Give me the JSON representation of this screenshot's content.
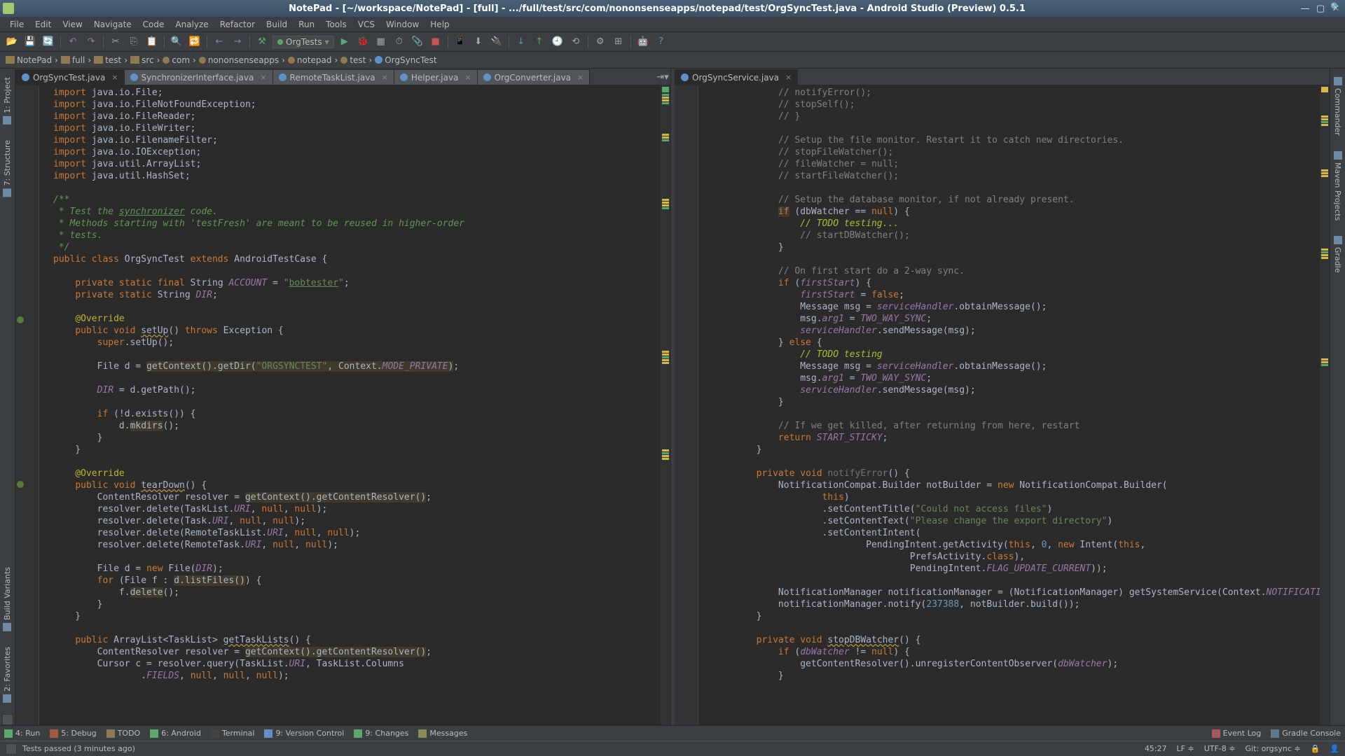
{
  "window": {
    "title": "NotePad - [~/workspace/NotePad] - [full] - .../full/test/src/com/nononsenseapps/notepad/test/OrgSyncTest.java - Android Studio (Preview) 0.5.1"
  },
  "menu": [
    "File",
    "Edit",
    "View",
    "Navigate",
    "Code",
    "Analyze",
    "Refactor",
    "Build",
    "Run",
    "Tools",
    "VCS",
    "Window",
    "Help"
  ],
  "runconfig": "OrgTests",
  "breadcrumbs": [
    "NotePad",
    "full",
    "test",
    "src",
    "com",
    "nononsenseapps",
    "notepad",
    "test",
    "OrgSyncTest"
  ],
  "left_tabs": [
    "1: Project",
    "7: Structure",
    "Build Variants",
    "2: Favorites"
  ],
  "right_tabs": [
    "Commander",
    "Maven Projects",
    "Gradle"
  ],
  "left_editor": {
    "tabs": [
      {
        "label": "OrgSyncTest.java",
        "active": true
      },
      {
        "label": "SynchronizerInterface.java",
        "active": false
      },
      {
        "label": "RemoteTaskList.java",
        "active": false
      },
      {
        "label": "Helper.java",
        "active": false
      },
      {
        "label": "OrgConverter.java",
        "active": false
      }
    ]
  },
  "right_editor": {
    "tabs": [
      {
        "label": "OrgSyncService.java",
        "active": true
      }
    ]
  },
  "bottom_tabs": [
    {
      "label": "4: Run"
    },
    {
      "label": "5: Debug"
    },
    {
      "label": "TODO"
    },
    {
      "label": "6: Android"
    },
    {
      "label": "Terminal"
    },
    {
      "label": "9: Version Control"
    },
    {
      "label": "9: Changes"
    },
    {
      "label": "Messages"
    }
  ],
  "bottom_right": [
    {
      "label": "Event Log"
    },
    {
      "label": "Gradle Console"
    }
  ],
  "status": {
    "msg": "Tests passed (3 minutes ago)",
    "pos": "45:27",
    "lf": "LF",
    "enc": "UTF-8",
    "git": "Git: orgsync"
  }
}
